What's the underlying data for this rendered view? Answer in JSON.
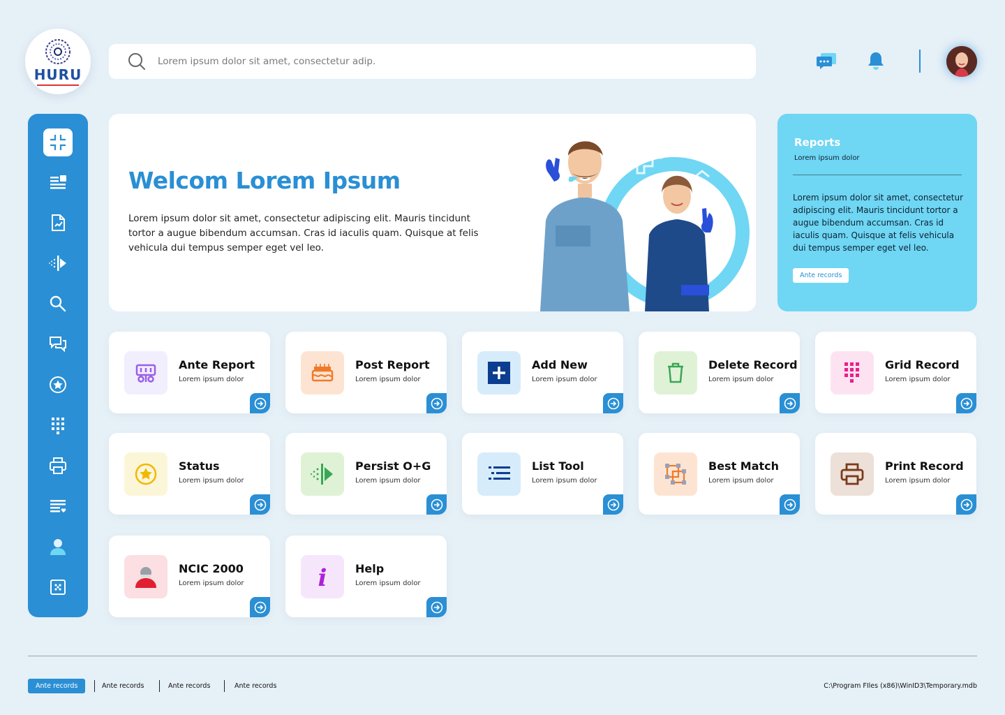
{
  "logo": {
    "name": "HURU"
  },
  "search": {
    "placeholder": "Lorem ipsum dolor sit amet, consectetur adip."
  },
  "header": {
    "chat_icon": "chat-bubble-icon",
    "bell_icon": "bell-icon",
    "avatar": "user-avatar"
  },
  "sidebar": {
    "items": [
      {
        "icon": "collapse-icon",
        "active": true
      },
      {
        "icon": "text-list-icon"
      },
      {
        "icon": "report-chart-icon"
      },
      {
        "icon": "persist-arrow-icon"
      },
      {
        "icon": "search-icon"
      },
      {
        "icon": "chat-icon"
      },
      {
        "icon": "star-circle-icon"
      },
      {
        "icon": "grid-dots-icon"
      },
      {
        "icon": "printer-icon"
      },
      {
        "icon": "list-heart-icon"
      },
      {
        "icon": "person-icon"
      },
      {
        "icon": "dotted-square-icon"
      }
    ]
  },
  "welcome": {
    "title": "Welcom Lorem Ipsum",
    "text": "Lorem ipsum dolor sit amet, consectetur adipiscing elit. Mauris tincidunt tortor a augue bibendum accumsan. Cras id iaculis quam. Quisque at felis vehicula dui tempus semper eget vel leo."
  },
  "reports": {
    "title": "Reports",
    "subtitle": "Lorem ipsum dolor",
    "text": "Lorem ipsum dolor sit amet, consectetur adipiscing elit. Mauris tincidunt tortor a augue bibendum accumsan. Cras id iaculis quam. Quisque at felis vehicula dui tempus semper eget vel leo.",
    "button": "Ante records"
  },
  "tiles": [
    {
      "title": "Ante Report",
      "sub": "Lorem ipsum dolor",
      "icon": "ante-report-icon",
      "bg": "#f1eefe"
    },
    {
      "title": "Post Report",
      "sub": "Lorem ipsum dolor",
      "icon": "post-report-icon",
      "bg": "#fde4d2"
    },
    {
      "title": "Add New",
      "sub": "Lorem ipsum dolor",
      "icon": "add-new-icon",
      "bg": "#d7ecfb"
    },
    {
      "title": "Delete Record",
      "sub": "Lorem ipsum dolor",
      "icon": "trash-icon",
      "bg": "#dff2d6"
    },
    {
      "title": "Grid Record",
      "sub": "Lorem ipsum dolor",
      "icon": "grid-record-icon",
      "bg": "#fde3f1"
    },
    {
      "title": "Status",
      "sub": "Lorem ipsum dolor",
      "icon": "status-star-icon",
      "bg": "#fcf6d8"
    },
    {
      "title": "Persist O+G",
      "sub": "Lorem ipsum dolor",
      "icon": "persist-icon",
      "bg": "#dff2d6"
    },
    {
      "title": "List Tool",
      "sub": "Lorem ipsum dolor",
      "icon": "list-tool-icon",
      "bg": "#d7ecfb"
    },
    {
      "title": "Best Match",
      "sub": "Lorem ipsum dolor",
      "icon": "best-match-icon",
      "bg": "#fde4d2"
    },
    {
      "title": "Print Record",
      "sub": "Lorem ipsum dolor",
      "icon": "print-record-icon",
      "bg": "#ece0d8"
    },
    {
      "title": "NCIC 2000",
      "sub": "Lorem ipsum dolor",
      "icon": "ncic-person-icon",
      "bg": "#fbdfe2"
    },
    {
      "title": "Help",
      "sub": "Lorem ipsum dolor",
      "icon": "help-info-icon",
      "bg": "#f6e6fb"
    }
  ],
  "footer": {
    "tabs": [
      "Ante records",
      "Ante records",
      "Ante records",
      "Ante records"
    ],
    "path": "C:\\Program FIles (x86)\\WinID3\\Temporary.mdb"
  },
  "colors": {
    "primary": "#2a8fd4",
    "reports_bg": "#6fd6f4",
    "page_bg": "#e6f0f7"
  }
}
